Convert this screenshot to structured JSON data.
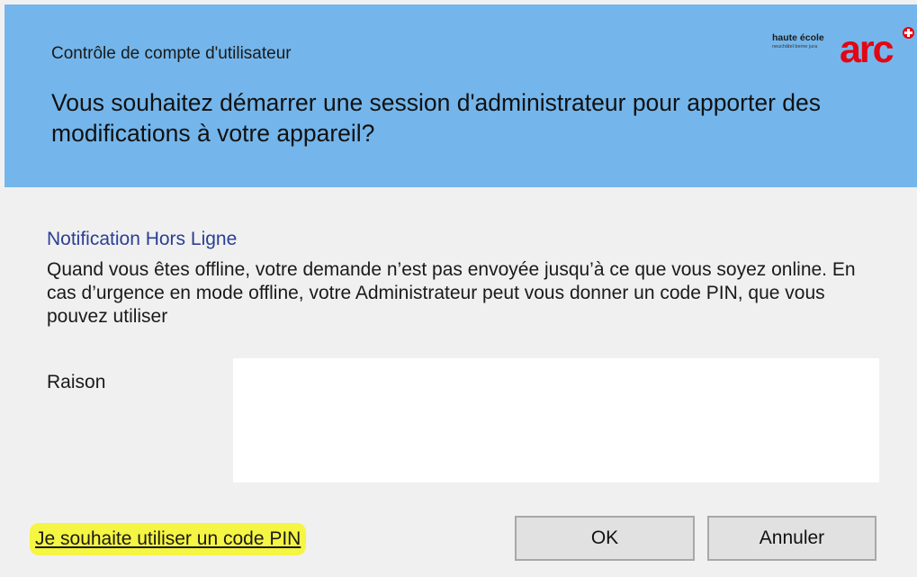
{
  "header": {
    "window_title": "Contrôle de compte d'utilisateur",
    "question": "Vous souhaitez démarrer une session d'administrateur pour apporter des modifications à votre appareil?",
    "background_color": "#74b6eb"
  },
  "logo": {
    "line1": "haute école",
    "line2": "neuchâtel berne jura",
    "wordmark": "arc",
    "color": "#e30613"
  },
  "notification": {
    "title": "Notification Hors Ligne",
    "text": "Quand vous êtes offline, votre demande n’est pas envoyée jusqu’à ce que vous soyez online. En cas d’urgence en mode offline, votre Administrateur peut vous donner un code PIN, que vous pouvez utiliser"
  },
  "reason": {
    "label": "Raison",
    "value": ""
  },
  "footer": {
    "pin_link": "Je souhaite utiliser un code PIN",
    "ok_label": "OK",
    "cancel_label": "Annuler"
  }
}
